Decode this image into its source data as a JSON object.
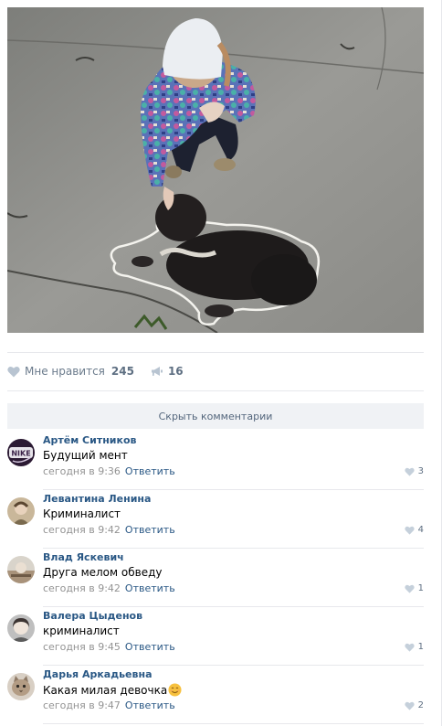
{
  "post": {
    "image_icon": "photo-girl-drawing-chalk-outline-around-black-puppy",
    "likes_label": "Мне нравится",
    "likes_count": "245",
    "shares_count": "16"
  },
  "comments_toggle_label": "Скрыть комментарии",
  "comments": [
    {
      "author": "Артём Ситников",
      "text": "Будущий мент",
      "time": "сегодня в 9:36",
      "reply": "Ответить",
      "likes": "3",
      "avatar_icon": "nike-logo-avatar"
    },
    {
      "author": "Левантина Ленина",
      "text": "Криминалист",
      "time": "сегодня в 9:42",
      "reply": "Ответить",
      "likes": "4",
      "avatar_icon": "photo-avatar"
    },
    {
      "author": "Влад Яскевич",
      "text": "Друга мелом обведу",
      "time": "сегодня в 9:42",
      "reply": "Ответить",
      "likes": "1",
      "avatar_icon": "photo-avatar"
    },
    {
      "author": "Валера Цыденов",
      "text": "криминалист",
      "time": "сегодня в 9:45",
      "reply": "Ответить",
      "likes": "1",
      "avatar_icon": "photo-avatar"
    },
    {
      "author": "Дарья Аркадьевна",
      "text": "Какая милая девочка",
      "time": "сегодня в 9:47",
      "reply": "Ответить",
      "likes": "2",
      "avatar_icon": "cat-photo-avatar",
      "emoji_icon": "smiling-face-emoji"
    }
  ],
  "colors": {
    "link": "#2a5885",
    "meta": "#939393",
    "action": "#5e6f82",
    "toggle_bg": "#f0f2f5",
    "separator": "#e7e8ec"
  }
}
